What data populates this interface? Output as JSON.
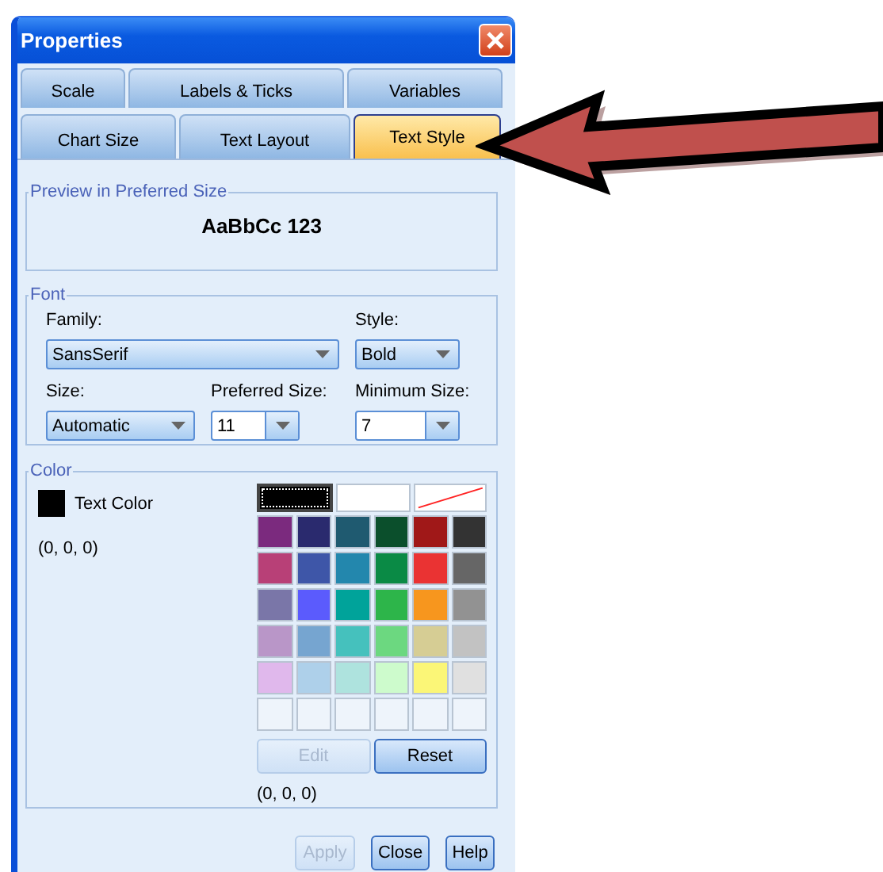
{
  "window": {
    "title": "Properties"
  },
  "tab_rows": [
    [
      {
        "label": "Scale",
        "selected": false
      },
      {
        "label": "Labels & Ticks",
        "selected": false
      },
      {
        "label": "Variables",
        "selected": false
      }
    ],
    [
      {
        "label": "Chart Size",
        "selected": false
      },
      {
        "label": "Text Layout",
        "selected": false
      },
      {
        "label": "Text Style",
        "selected": true
      }
    ]
  ],
  "preview": {
    "title": "Preview in Preferred Size",
    "sample": "AaBbCc 123"
  },
  "font": {
    "title": "Font",
    "fields": [
      {
        "label": "Family:",
        "value": "SansSerif",
        "editable": false
      },
      {
        "label": "Style:",
        "value": "Bold",
        "editable": false
      },
      {
        "label": "Size:",
        "value": "Automatic",
        "editable": false
      },
      {
        "label": "Preferred Size:",
        "value": "11",
        "editable": true
      },
      {
        "label": "Minimum Size:",
        "value": "7",
        "editable": true
      }
    ]
  },
  "color": {
    "title": "Color",
    "text_color": {
      "label": "Text Color",
      "color": "#000000",
      "value": "(0, 0, 0)"
    },
    "palette": [
      [
        {
          "kind": "color",
          "color": "#000000",
          "selected": true
        },
        {
          "kind": "color",
          "color": "#ffffff",
          "selected": false
        },
        {
          "kind": "none",
          "selected": false
        }
      ],
      [
        {
          "kind": "color",
          "color": "#7b2a7e",
          "selected": false
        },
        {
          "kind": "color",
          "color": "#2a2a6e",
          "selected": false
        },
        {
          "kind": "color",
          "color": "#1f5a70",
          "selected": false
        },
        {
          "kind": "color",
          "color": "#0b4f2c",
          "selected": false
        },
        {
          "kind": "color",
          "color": "#a01818",
          "selected": false
        },
        {
          "kind": "color",
          "color": "#333333",
          "selected": false
        }
      ],
      [
        {
          "kind": "color",
          "color": "#b84077",
          "selected": false
        },
        {
          "kind": "color",
          "color": "#3e56a8",
          "selected": false
        },
        {
          "kind": "color",
          "color": "#2387ad",
          "selected": false
        },
        {
          "kind": "color",
          "color": "#0a8a45",
          "selected": false
        },
        {
          "kind": "color",
          "color": "#ea3333",
          "selected": false
        },
        {
          "kind": "color",
          "color": "#666666",
          "selected": false
        }
      ],
      [
        {
          "kind": "color",
          "color": "#7a76a8",
          "selected": false
        },
        {
          "kind": "color",
          "color": "#5b5bfd",
          "selected": false
        },
        {
          "kind": "color",
          "color": "#00a39a",
          "selected": false
        },
        {
          "kind": "color",
          "color": "#2db54a",
          "selected": false
        },
        {
          "kind": "color",
          "color": "#f7961e",
          "selected": false
        },
        {
          "kind": "color",
          "color": "#929292",
          "selected": false
        }
      ],
      [
        {
          "kind": "color",
          "color": "#b996c8",
          "selected": false
        },
        {
          "kind": "color",
          "color": "#76a5d0",
          "selected": false
        },
        {
          "kind": "color",
          "color": "#45c1bd",
          "selected": false
        },
        {
          "kind": "color",
          "color": "#6cd880",
          "selected": false
        },
        {
          "kind": "color",
          "color": "#d6cd94",
          "selected": false
        },
        {
          "kind": "color",
          "color": "#c2c2c2",
          "selected": false
        }
      ],
      [
        {
          "kind": "color",
          "color": "#e0b8ec",
          "selected": false
        },
        {
          "kind": "color",
          "color": "#aed0ea",
          "selected": false
        },
        {
          "kind": "color",
          "color": "#aee3de",
          "selected": false
        },
        {
          "kind": "color",
          "color": "#cdfbcc",
          "selected": false
        },
        {
          "kind": "color",
          "color": "#fbf677",
          "selected": false
        },
        {
          "kind": "color",
          "color": "#e0e0e0",
          "selected": false
        }
      ],
      [
        {
          "kind": "empty",
          "selected": false
        },
        {
          "kind": "empty",
          "selected": false
        },
        {
          "kind": "empty",
          "selected": false
        },
        {
          "kind": "empty",
          "selected": false
        },
        {
          "kind": "empty",
          "selected": false
        },
        {
          "kind": "empty",
          "selected": false
        }
      ]
    ],
    "buttons": [
      {
        "label": "Edit",
        "disabled": true
      },
      {
        "label": "Reset",
        "disabled": false
      }
    ],
    "selected_value": "(0, 0, 0)"
  },
  "buttons": [
    {
      "label": "Apply",
      "disabled": true
    },
    {
      "label": "Close",
      "disabled": false
    },
    {
      "label": "Help",
      "disabled": false
    }
  ]
}
